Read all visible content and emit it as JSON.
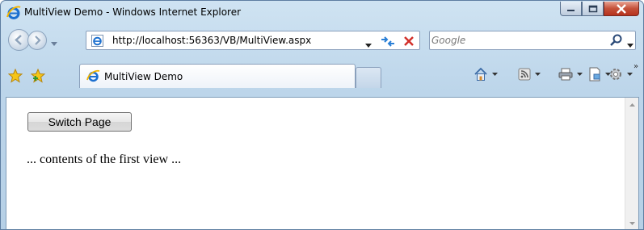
{
  "window": {
    "title": "MultiView Demo - Windows Internet Explorer"
  },
  "address_bar": {
    "url": "http://localhost:56363/VB/MultiView.aspx"
  },
  "search": {
    "placeholder": "Google"
  },
  "tabs": [
    {
      "label": "MultiView Demo",
      "icon": "ie-page-icon"
    }
  ],
  "command_bar": {
    "items": [
      "home-icon",
      "feeds-icon",
      "print-icon",
      "page-icon",
      "tools-icon"
    ],
    "more": "»"
  },
  "page": {
    "switch_button_label": "Switch Page",
    "view_text": "... contents of the first view ..."
  },
  "colors": {
    "chrome": "#bcd5ea",
    "close_button": "#c5513a",
    "content_bg": "#ffffff"
  }
}
